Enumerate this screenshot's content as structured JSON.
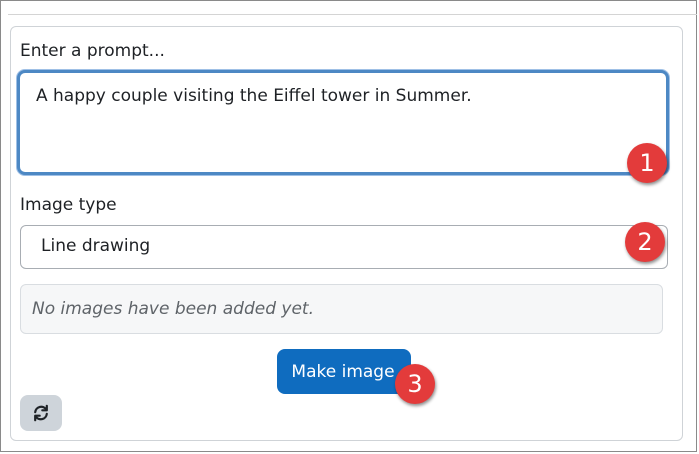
{
  "form": {
    "prompt_label": "Enter a prompt...",
    "prompt_value": "A happy couple visiting the Eiffel tower in Summer.",
    "image_type_label": "Image type",
    "image_type_value": "Line drawing",
    "empty_message": "No images have been added yet.",
    "make_button_label": "Make image",
    "refresh_icon": "refresh-icon"
  },
  "markers": [
    "1",
    "2",
    "3"
  ],
  "colors": {
    "primary_button": "#0f6cbf",
    "marker": "#e33b3b",
    "focus_border": "#4d88c4"
  }
}
